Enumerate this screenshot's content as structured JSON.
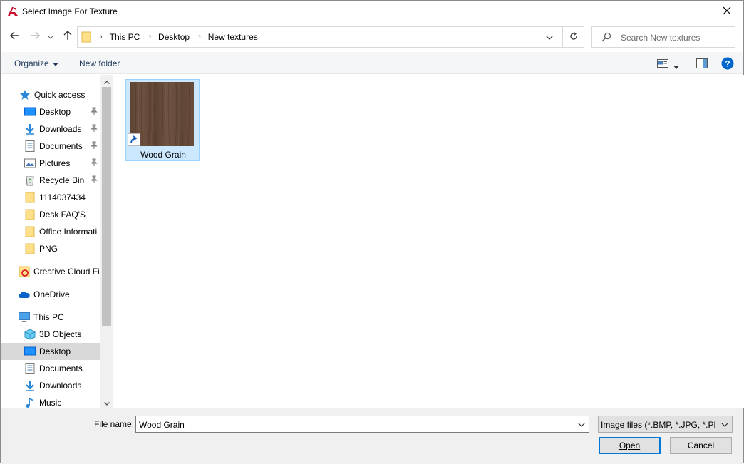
{
  "window": {
    "title": "Select Image For Texture"
  },
  "breadcrumb": [
    "This PC",
    "Desktop",
    "New textures"
  ],
  "search": {
    "placeholder": "Search New textures"
  },
  "toolbar": {
    "organize_label": "Organize",
    "new_folder_label": "New folder"
  },
  "sidebar": {
    "items": [
      {
        "label": "Quick access",
        "icon": "star-icon"
      },
      {
        "label": "Desktop",
        "icon": "desktop-icon",
        "pinned": true
      },
      {
        "label": "Downloads",
        "icon": "download-icon",
        "pinned": true
      },
      {
        "label": "Documents",
        "icon": "document-icon",
        "pinned": true
      },
      {
        "label": "Pictures",
        "icon": "pictures-icon",
        "pinned": true
      },
      {
        "label": "Recycle Bin",
        "icon": "recycle-bin-icon",
        "pinned": true
      },
      {
        "label": "1114037434",
        "icon": "folder-icon"
      },
      {
        "label": "Desk FAQ'S",
        "icon": "folder-icon"
      },
      {
        "label": "Office Informati",
        "icon": "folder-icon"
      },
      {
        "label": "PNG",
        "icon": "folder-icon"
      },
      {
        "label": "Creative Cloud Fil",
        "icon": "creative-cloud-icon"
      },
      {
        "label": "OneDrive",
        "icon": "onedrive-icon"
      },
      {
        "label": "This PC",
        "icon": "computer-icon"
      },
      {
        "label": "3D Objects",
        "icon": "3d-objects-icon"
      },
      {
        "label": "Desktop",
        "icon": "desktop-icon",
        "selected": true
      },
      {
        "label": "Documents",
        "icon": "document-icon"
      },
      {
        "label": "Downloads",
        "icon": "download-icon"
      },
      {
        "label": "Music",
        "icon": "music-icon"
      }
    ]
  },
  "files": [
    {
      "name": "Wood Grain",
      "type": "shortcut",
      "selected": true
    }
  ],
  "bottom": {
    "file_name_label": "File name:",
    "file_name_value": "Wood Grain",
    "file_type_value": "Image files (*.BMP, *.JPG, *.PNG)",
    "open_label": "Open",
    "cancel_label": "Cancel"
  },
  "colors": {
    "accent": "#0078d7",
    "selection": "#cce8ff",
    "help": "#0066cc"
  }
}
